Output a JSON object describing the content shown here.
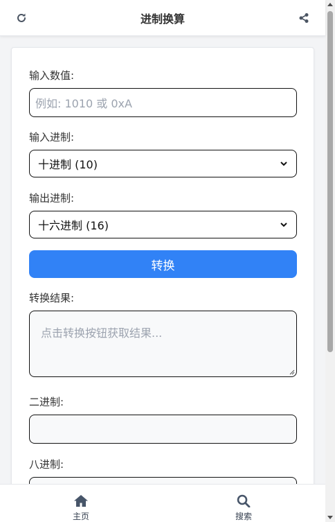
{
  "header": {
    "title": "进制换算",
    "left_icon": "refresh-icon",
    "right_icon": "share-icon"
  },
  "form": {
    "input_value_label": "输入数值:",
    "input_value_placeholder": "例如: 1010 或 0xA",
    "input_value": "",
    "input_base_label": "输入进制:",
    "input_base_selected": "十进制 (10)",
    "output_base_label": "输出进制:",
    "output_base_selected": "十六进制 (16)",
    "convert_label": "转换",
    "result_label": "转换结果:",
    "result_placeholder": "点击转换按钮获取结果...",
    "binary_label": "二进制:",
    "binary_value": "",
    "octal_label": "八进制:",
    "octal_value": ""
  },
  "bottom_nav": {
    "items": [
      {
        "label": "主页",
        "icon": "home-icon"
      },
      {
        "label": "搜索",
        "icon": "search-icon"
      }
    ]
  },
  "colors": {
    "accent": "#3182f6",
    "text": "#333333",
    "placeholder": "#9ca3af",
    "background": "#f3f4f6"
  }
}
